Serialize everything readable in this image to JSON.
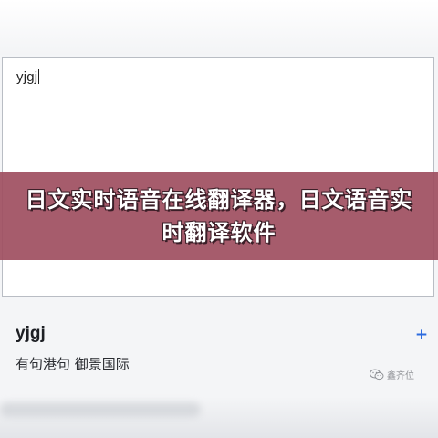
{
  "input": {
    "text": "yjgj"
  },
  "banner": {
    "title": "日文实时语音在线翻译器，日文语音实时翻译软件"
  },
  "result": {
    "word": "yjgj",
    "add_label": "+",
    "translation": "有句港句   御景国际"
  },
  "watermark": {
    "text": "鑫齐位",
    "icon": "wechat-icon"
  },
  "colors": {
    "banner": "#9e4e60",
    "accent": "#2d6cdf"
  }
}
